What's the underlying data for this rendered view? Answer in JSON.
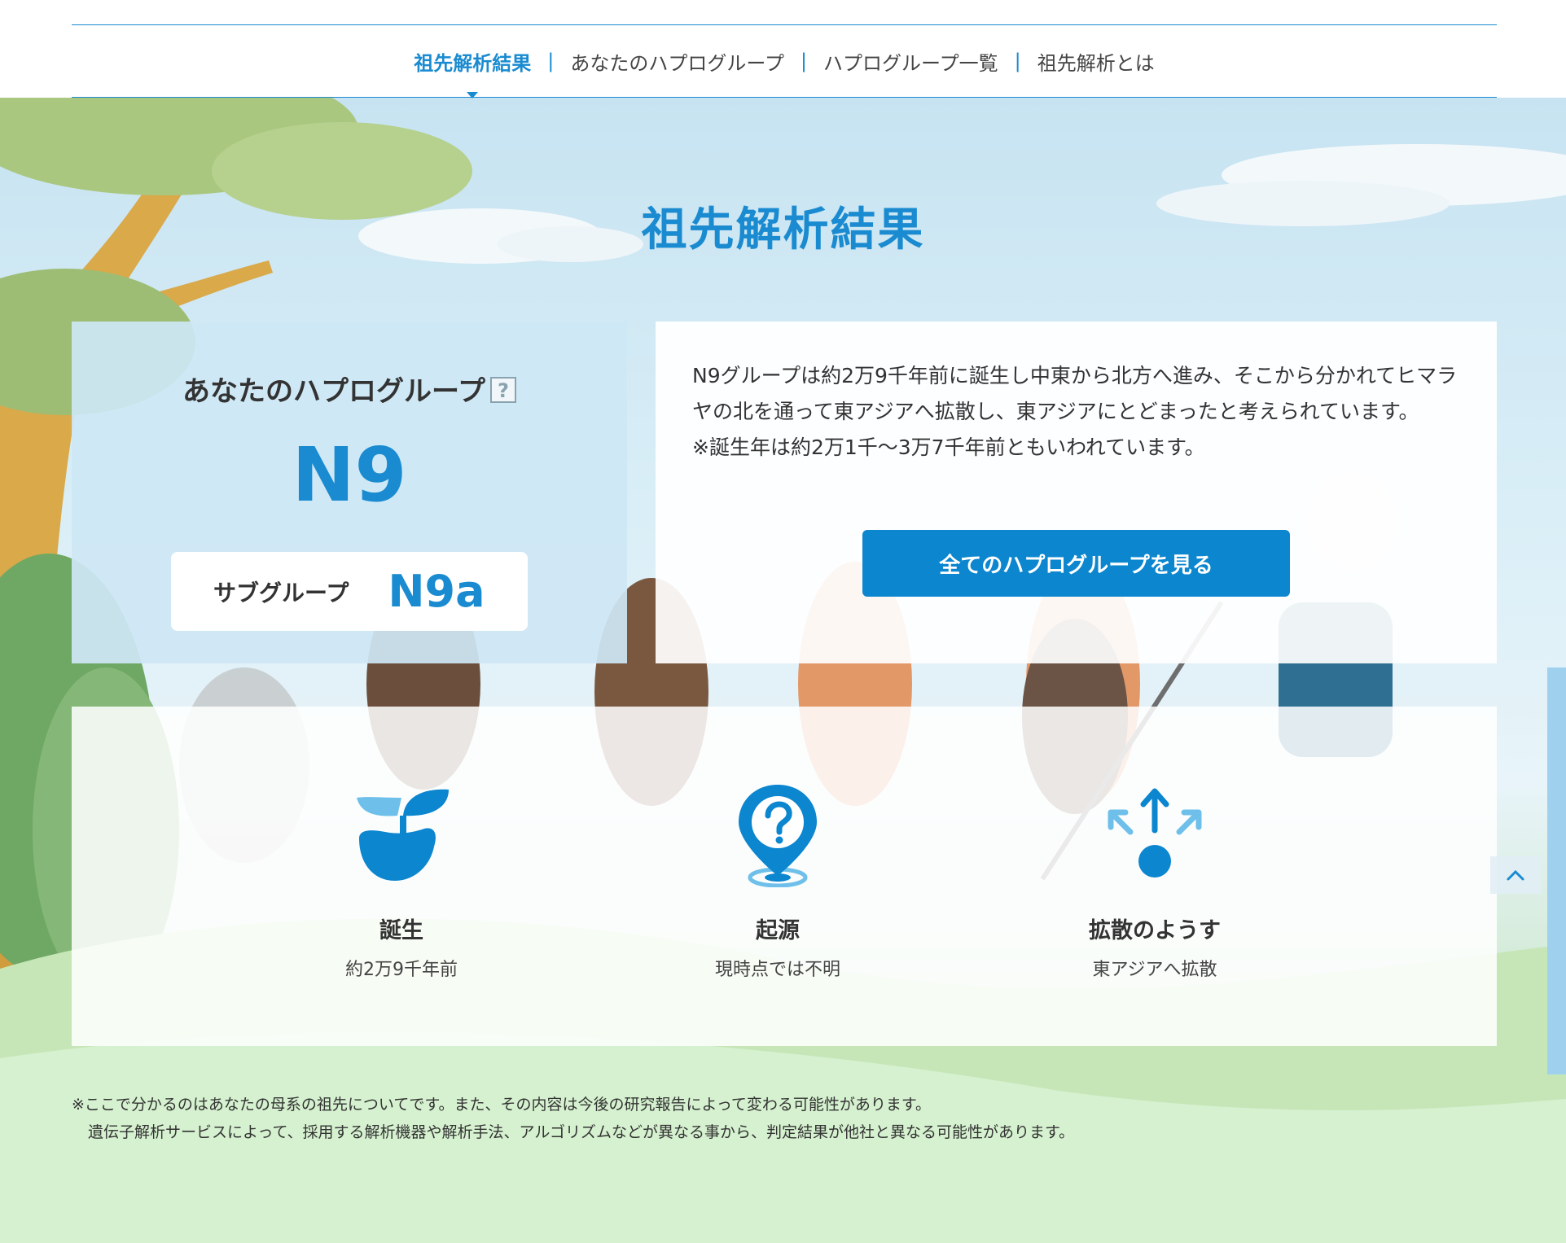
{
  "nav": {
    "items": [
      {
        "label": "祖先解析結果",
        "active": true
      },
      {
        "label": "あなたのハプログループ",
        "active": false
      },
      {
        "label": "ハプログループ一覧",
        "active": false
      },
      {
        "label": "祖先解析とは",
        "active": false
      }
    ],
    "separator": "|"
  },
  "page_title": "祖先解析結果",
  "haplogroup": {
    "label": "あなたのハプログループ",
    "help_icon": "?",
    "code": "N9",
    "subgroup_label": "サブグループ",
    "subgroup_code": "N9a"
  },
  "description": {
    "text": "N9グループは約2万9千年前に誕生し中東から北方へ進み、そこから分かれてヒマラヤの北を通って東アジアへ拡散し、東アジアにとどまったと考えられています。",
    "note": "※誕生年は約2万1千〜3万7千年前ともいわれています。",
    "button_label": "全てのハプログループを見る"
  },
  "info": [
    {
      "icon": "sprout-icon",
      "title": "誕生",
      "value": "約2万9千年前"
    },
    {
      "icon": "location-question-icon",
      "title": "起源",
      "value": "現時点では不明"
    },
    {
      "icon": "spread-arrows-icon",
      "title": "拡散のようす",
      "value": "東アジアへ拡散"
    }
  ],
  "footnotes": {
    "line1": "※ここで分かるのはあなたの母系の祖先についてです。また、その内容は今後の研究報告によって変わる可能性があります。",
    "line2": "遺伝子解析サービスによって、採用する解析機器や解析手法、アルゴリズムなどが異なる事から、判定結果が他社と異なる可能性があります。"
  },
  "colors": {
    "accent": "#1a8bd0",
    "button": "#0b86cf",
    "icon_light": "#6ec0ea"
  }
}
